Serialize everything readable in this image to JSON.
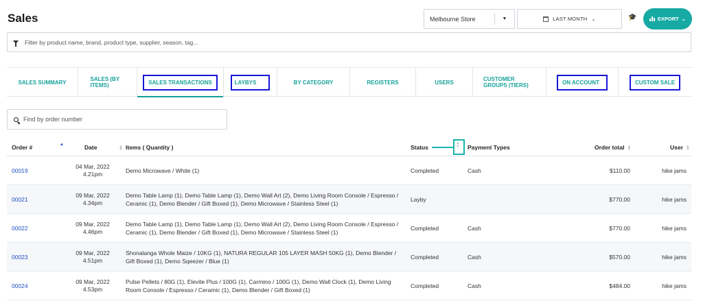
{
  "header": {
    "title": "Sales",
    "store_value": "Melbourne Store",
    "date_range_label": "LAST MONTH",
    "export_label": "EXPORT"
  },
  "filter": {
    "placeholder": "Filter by product name, brand, product type, supplier, season, tag..."
  },
  "tabs": [
    {
      "label": "SALES SUMMARY"
    },
    {
      "label": "SALES (BY ITEMS)"
    },
    {
      "label": "SALES TRANSACTIONS"
    },
    {
      "label": "LAYBYS"
    },
    {
      "label": "BY CATEGORY"
    },
    {
      "label": "REGISTERS"
    },
    {
      "label": "USERS"
    },
    {
      "label": "CUSTOMER GROUPS (TIERS)"
    },
    {
      "label": "ON ACCOUNT"
    },
    {
      "label": "CUSTOM SALE"
    }
  ],
  "search": {
    "placeholder": "Find by order number"
  },
  "table": {
    "columns": {
      "order": "Order #",
      "date": "Date",
      "items": "Items ( Quantity )",
      "status": "Status",
      "payment": "Payment Types",
      "total": "Order total",
      "user": "User"
    },
    "rows": [
      {
        "order": "00019",
        "date": "04 Mar, 2022",
        "time": "4.21pm",
        "items": "Demo Microwave / White (1)",
        "status": "Completed",
        "payment": "Cash",
        "total": "$110.00",
        "user": "hike jams"
      },
      {
        "order": "00021",
        "date": "09 Mar, 2022",
        "time": "4.34pm",
        "items": "Demo Table Lamp (1), Demo Table Lamp (1), Demo Wall Art (2), Demo Living Room Console / Espresso / Ceramic (1), Demo Blender / Gift Boxed (1), Demo Microwave / Stainless Steel (1)",
        "status": "Layby",
        "payment": "",
        "total": "$770.00",
        "user": "hike jams"
      },
      {
        "order": "00022",
        "date": "09 Mar, 2022",
        "time": "4.46pm",
        "items": "Demo Table Lamp (1), Demo Table Lamp (1), Demo Wall Art (2), Demo Living Room Console / Espresso / Ceramic (1), Demo Blender / Gift Boxed (1), Demo Microwave / Stainless Steel (1)",
        "status": "Completed",
        "payment": "Cash",
        "total": "$770.00",
        "user": "hike jams"
      },
      {
        "order": "00023",
        "date": "09 Mar, 2022",
        "time": "4.51pm",
        "items": "Shonalanga Whole Maize / 10KG (1), NATURA REGULAR 105 LAYER MASH 50KG (1), Demo Blender / Gift Boxed (1), Demo Sqeezer / Blue (1)",
        "status": "Completed",
        "payment": "Cash",
        "total": "$570.00",
        "user": "hike jams"
      },
      {
        "order": "00024",
        "date": "09 Mar, 2022",
        "time": "4.53pm",
        "items": "Pulse Pellets / 80G (1), Elevite Plus / 100G (1), Carmino / 100G (1), Demo Wall Clock (1), Demo Living Room Console / Espresso / Ceramic (1), Demo Blender / Gift Boxed (1)",
        "status": "Completed",
        "payment": "Cash",
        "total": "$484.00",
        "user": "hike jams"
      }
    ]
  },
  "colors": {
    "accent": "#17a9a3",
    "link": "#1e4fc3",
    "highlight_box": "#1616d8"
  }
}
